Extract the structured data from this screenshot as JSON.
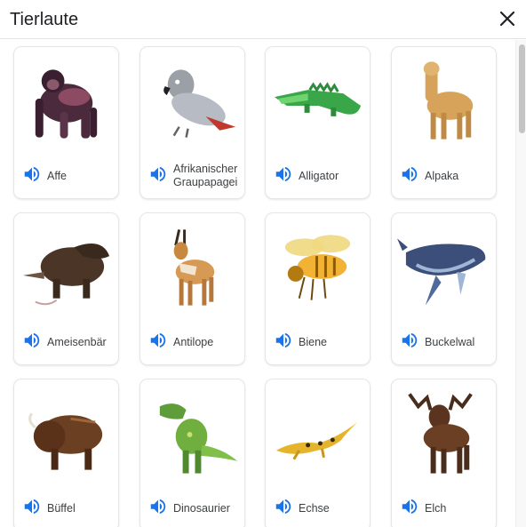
{
  "dialog": {
    "title": "Tierlaute"
  },
  "icons": {
    "close": "close-icon",
    "speaker": "volume-up-icon"
  },
  "colors": {
    "speaker": "#1a73e8",
    "text": "#3c4043"
  },
  "animals": [
    {
      "label": "Affe",
      "icon": "gorilla"
    },
    {
      "label": "Afrikanischer Graupapagei",
      "icon": "parrot"
    },
    {
      "label": "Alligator",
      "icon": "alligator"
    },
    {
      "label": "Alpaka",
      "icon": "alpaca"
    },
    {
      "label": "Ameisenbär",
      "icon": "anteater"
    },
    {
      "label": "Antilope",
      "icon": "antelope"
    },
    {
      "label": "Biene",
      "icon": "bee"
    },
    {
      "label": "Buckelwal",
      "icon": "humpback-whale"
    },
    {
      "label": "Büffel",
      "icon": "buffalo"
    },
    {
      "label": "Dinosaurier",
      "icon": "dinosaur"
    },
    {
      "label": "Echse",
      "icon": "lizard"
    },
    {
      "label": "Elch",
      "icon": "moose"
    }
  ]
}
